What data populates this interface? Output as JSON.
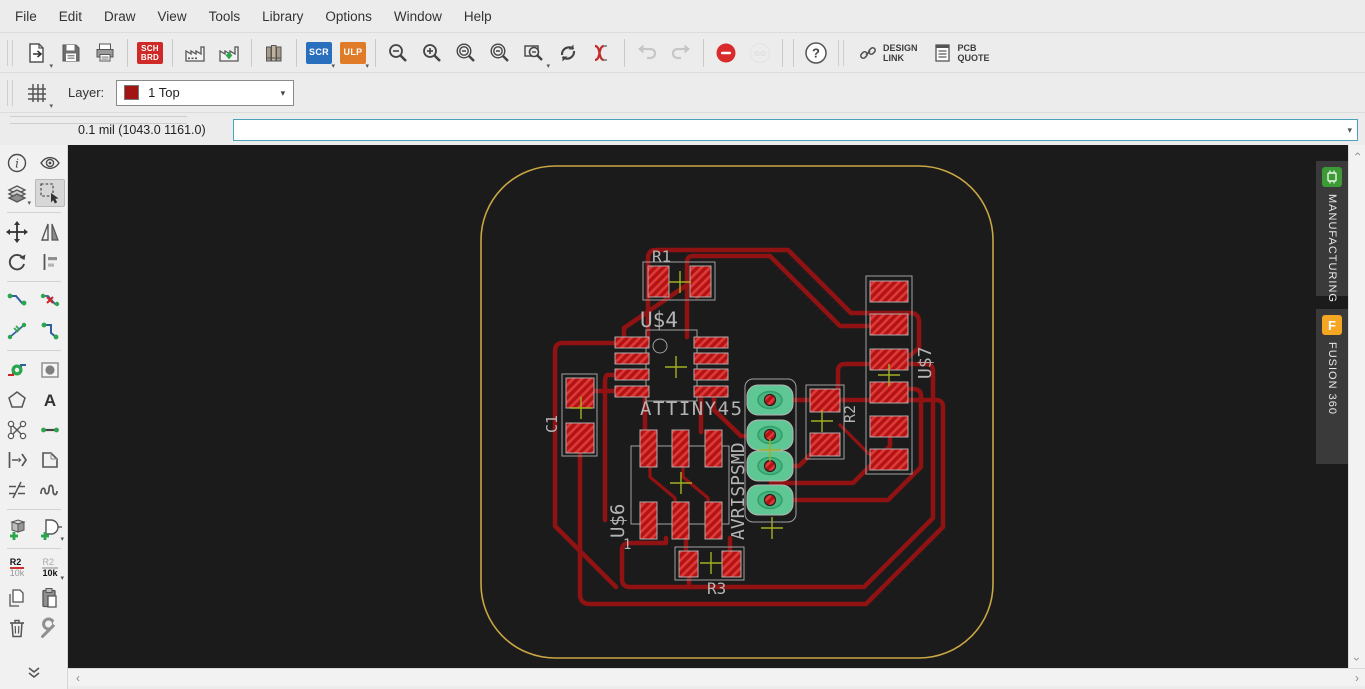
{
  "menu_bar": {
    "items": [
      "File",
      "Edit",
      "Draw",
      "View",
      "Tools",
      "Library",
      "Options",
      "Window",
      "Help"
    ]
  },
  "toolbar": {
    "sch_badge_line1": "SCH",
    "sch_badge_line2": "BRD",
    "scr_badge": "SCR",
    "ulp_badge": "ULP",
    "go_label": "GO",
    "help_glyph": "?",
    "design_link_line1": "DESIGN",
    "design_link_line2": "LINK",
    "pcb_quote_line1": "PCB",
    "pcb_quote_line2": "QUOTE"
  },
  "layer_bar": {
    "label": "Layer:",
    "selected_layer": "1 Top",
    "selected_layer_color": "#a31515"
  },
  "command_bar": {
    "readout": "0.1 mil (1043.0 1161.0)",
    "command_value": ""
  },
  "palette": {
    "info_glyph": "i",
    "text_tool_glyph": "A",
    "name_tool_top": "R2",
    "name_tool_bottom": "10k",
    "value_tool_top": "R2",
    "value_tool_bottom": "10k"
  },
  "side_panel": {
    "tabs": [
      {
        "label": "MANUFACTURING",
        "icon": "chip-icon",
        "icon_color": "#3d9b35"
      },
      {
        "label": "FUSION 360",
        "icon": "fusion-f-icon",
        "icon_color": "#f5a623"
      }
    ],
    "fusion_badge": "F"
  },
  "board": {
    "labels": {
      "r1": "R1",
      "u4": "U$4",
      "u4_part": "ATTINY45",
      "c1": "C1",
      "u6": "U$6",
      "u6_pin": "1",
      "r3": "R3",
      "connector": "AVRISPSMD",
      "r2": "R2",
      "u7": "U$7"
    },
    "colors": {
      "canvas": "#1b1b1b",
      "outline": "#c9a643",
      "trace": "#911212",
      "pad_fill": "#b31313",
      "pad_hatch": "#de3a3a",
      "pth_pad": "#5fc794",
      "silkscreen": "#b4b4b4",
      "origin_cross": "#a3b023"
    }
  }
}
